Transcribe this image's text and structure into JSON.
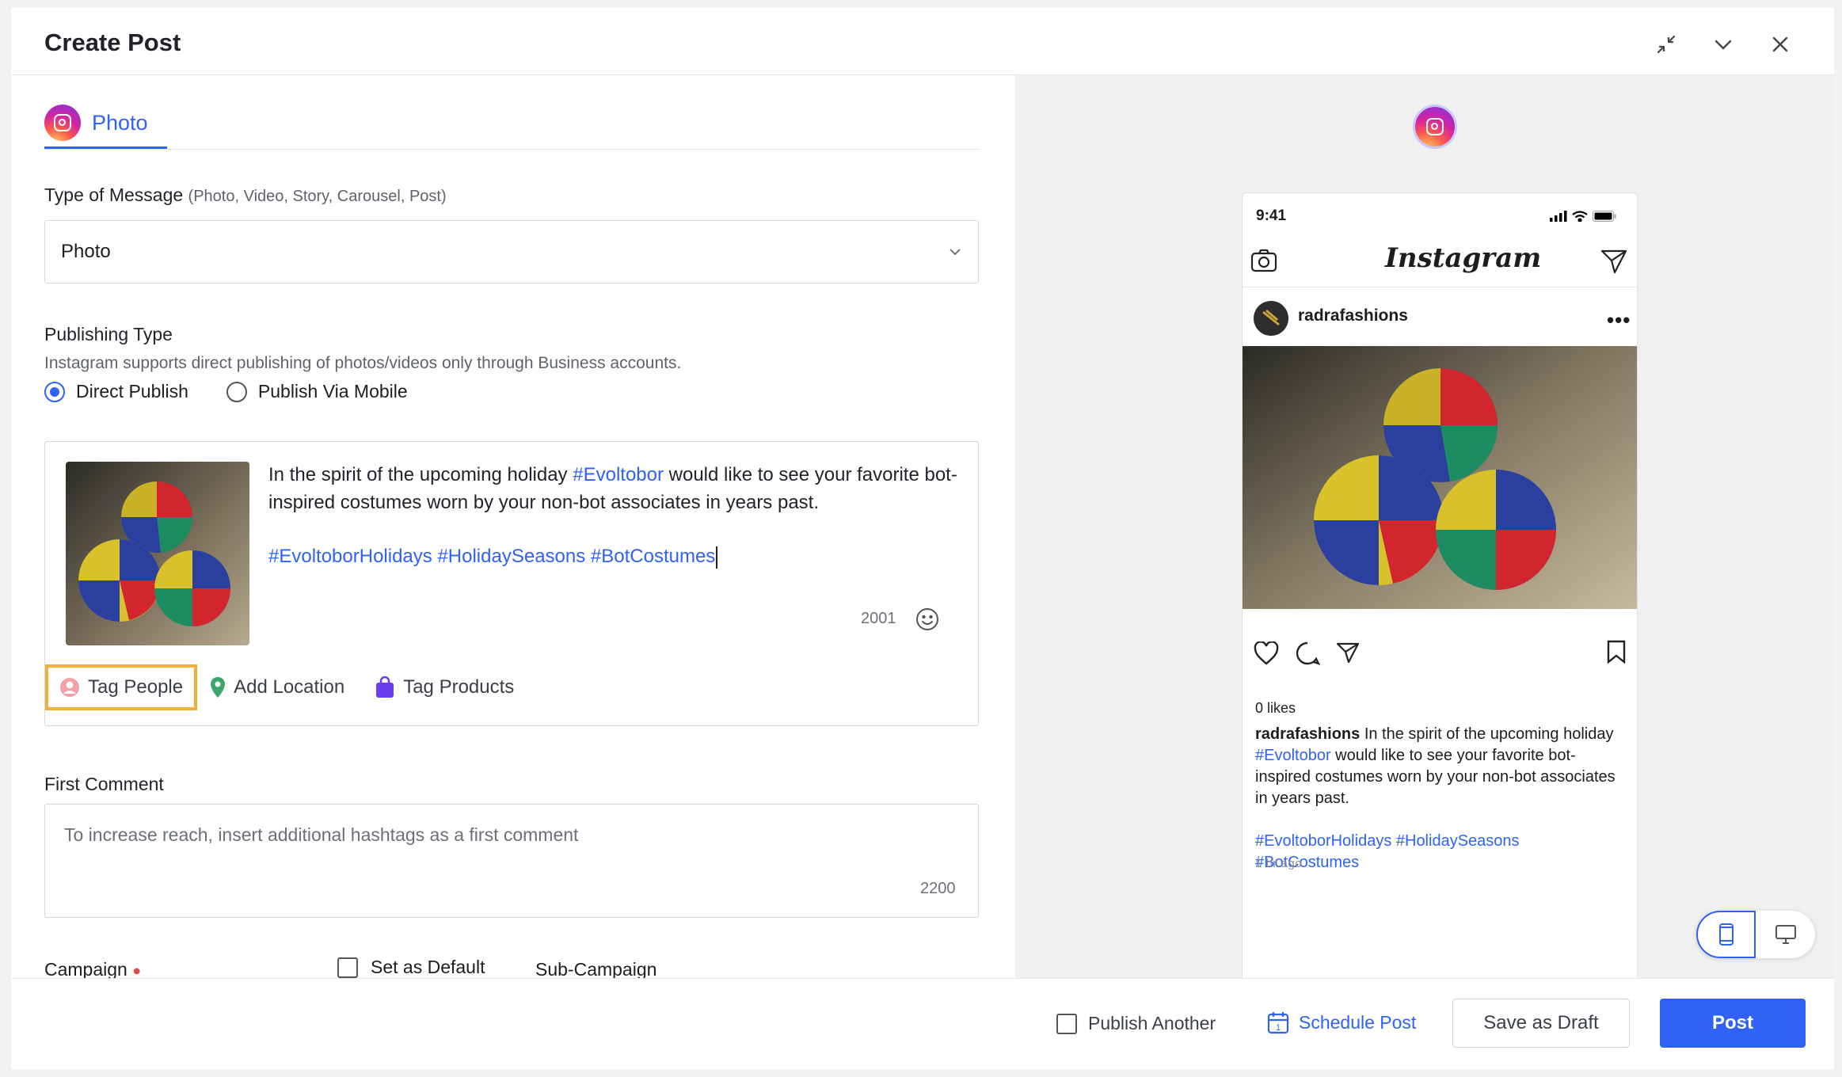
{
  "dialog": {
    "title": "Create Post"
  },
  "tab": {
    "label": "Photo"
  },
  "message_type": {
    "label": "Type of Message",
    "note": "(Photo, Video, Story, Carousel, Post)",
    "value": "Photo"
  },
  "publishing": {
    "label": "Publishing Type",
    "help": "Instagram supports direct publishing of photos/videos only through Business accounts.",
    "options": [
      "Direct Publish",
      "Publish Via Mobile"
    ],
    "selected": "Direct Publish"
  },
  "composer": {
    "text_a": "In the spirit of the upcoming holiday ",
    "tag_a": "#Evoltobor",
    "text_b": " would like to see your favorite bot-inspired costumes worn by your non-bot associates in years past.",
    "hashtags": "#EvoltoborHolidays #HolidaySeasons #BotCostumes",
    "counter": "2001",
    "actions": {
      "tag_people": "Tag People",
      "add_location": "Add Location",
      "tag_products": "Tag Products"
    }
  },
  "first_comment": {
    "label": "First Comment",
    "placeholder": "To increase reach, insert additional hashtags as a first comment",
    "counter": "2200"
  },
  "campaign": {
    "label": "Campaign",
    "set_default": "Set as Default",
    "sub_campaign": "Sub-Campaign"
  },
  "preview": {
    "time": "9:41",
    "app_logo": "Instagram",
    "username": "radrafashions",
    "likes": "0 likes",
    "caption_user": "radrafashions",
    "caption_a": " In the spirit of the upcoming holiday ",
    "caption_tag": "#Evoltobor",
    "caption_b": " would like to see your favorite bot-inspired costumes worn by your non-bot associates in years past.",
    "caption_hashtags_1": "#EvoltoborHolidays #HolidaySeasons",
    "caption_hashtags_2": "#BotCostumes",
    "ago": "1 hr ago"
  },
  "footer": {
    "publish_another": "Publish Another",
    "schedule": "Schedule Post",
    "draft": "Save as Draft",
    "post": "Post"
  },
  "colors": {
    "accent": "#2f62f5",
    "highlight": "#f0b03c",
    "required": "#e04b4b"
  }
}
